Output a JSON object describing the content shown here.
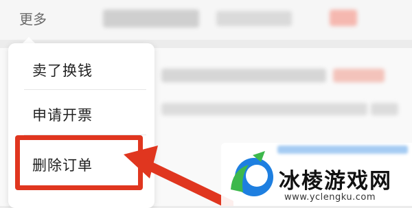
{
  "header": {
    "more_label": "更多"
  },
  "menu": {
    "items": [
      {
        "label": "卖了换钱"
      },
      {
        "label": "申请开票"
      },
      {
        "label": "删除订单"
      }
    ],
    "highlighted_index": 2
  },
  "watermark": {
    "title": "冰棱游戏网",
    "url": "www.yclengku.com"
  },
  "colors": {
    "highlight": "#e0361f",
    "logo_green": "#3db84c",
    "logo_blue": "#1e7fe0"
  }
}
